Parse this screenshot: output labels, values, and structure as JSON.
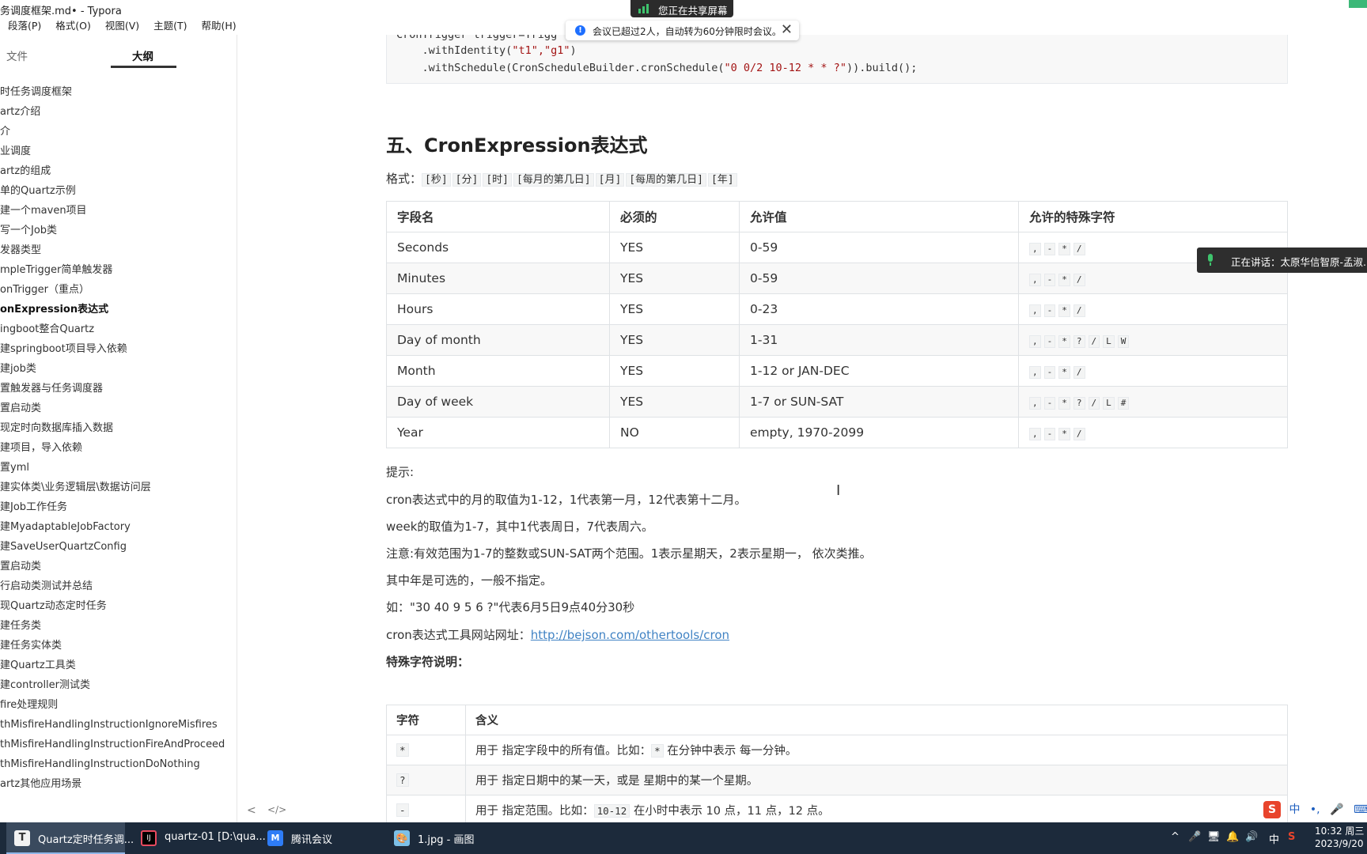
{
  "window": {
    "title": "务调度框架.md• - Typora"
  },
  "menu": [
    "段落(P)",
    "格式(O)",
    "视图(V)",
    "主题(T)",
    "帮助(H)"
  ],
  "sidebar": {
    "tab_file": "文件",
    "tab_outline": "大纲",
    "outline": [
      "时任务调度框架",
      "artz介绍",
      "介",
      "业调度",
      "artz的组成",
      "单的Quartz示例",
      "建一个maven项目",
      "写一个Job类",
      "发器类型",
      "mpleTrigger简单触发器",
      "onTrigger（重点）",
      "onExpression表达式",
      "ingboot整合Quartz",
      "建springboot项目导入依赖",
      "建job类",
      "置触发器与任务调度器",
      "置启动类",
      "现定时向数据库插入数据",
      "建项目，导入依赖",
      "置yml",
      "建实体类\\业务逻辑层\\数据访问层",
      "建Job工作任务",
      "建MyadaptableJobFactory",
      "建SaveUserQuartzConfig",
      "置启动类",
      "行启动类测试并总结",
      "现Quartz动态定时任务",
      "建任务类",
      "建任务实体类",
      "建Quartz工具类",
      "建controller测试类",
      "fire处理规则",
      "thMisfireHandlingInstructionIgnoreMisfires",
      "thMisfireHandlingInstructionFireAndProceed",
      "thMisfireHandlingInstructionDoNothing",
      "artz其他应用场景"
    ],
    "active_index": 11,
    "bottom_left": "<",
    "bottom_code": "</>"
  },
  "code": {
    "line1": "CronTrigger trigger=Trigg",
    "line2_pre": "    .withIdentity(",
    "line2_str": "\"t1\",\"g1\"",
    "line2_post": ")",
    "line3_pre": "    .withSchedule(CronScheduleBuilder.cronSchedule(",
    "line3_str": "\"0 0/2 10-12 * * ?\"",
    "line3_post": ")).build();"
  },
  "heading": "五、CronExpression表达式",
  "format_label": "格式：",
  "format_parts": [
    "[秒]",
    "[分]",
    "[时]",
    "[每月的第几日]",
    "[月]",
    "[每周的第几日]",
    "[年]"
  ],
  "fields_table": {
    "headers": [
      "字段名",
      "必须的",
      "允许值",
      "允许的特殊字符"
    ],
    "rows": [
      {
        "name": "Seconds",
        "required": "YES",
        "allowed": "0-59",
        "chars": [
          ",",
          "-",
          "*",
          "/"
        ]
      },
      {
        "name": "Minutes",
        "required": "YES",
        "allowed": "0-59",
        "chars": [
          ",",
          "-",
          "*",
          "/"
        ]
      },
      {
        "name": "Hours",
        "required": "YES",
        "allowed": "0-23",
        "chars": [
          ",",
          "-",
          "*",
          "/"
        ]
      },
      {
        "name": "Day of month",
        "required": "YES",
        "allowed": "1-31",
        "chars": [
          ",",
          "-",
          "*",
          "?",
          "/",
          "L",
          "W"
        ]
      },
      {
        "name": "Month",
        "required": "YES",
        "allowed": "1-12 or JAN-DEC",
        "chars": [
          ",",
          "-",
          "*",
          "/"
        ]
      },
      {
        "name": "Day of week",
        "required": "YES",
        "allowed": "1-7 or SUN-SAT",
        "chars": [
          ",",
          "-",
          "*",
          "?",
          "/",
          "L",
          "#"
        ]
      },
      {
        "name": "Year",
        "required": "NO",
        "allowed": "empty, 1970-2099",
        "chars": [
          ",",
          "-",
          "*",
          "/"
        ]
      }
    ]
  },
  "tips": {
    "label": "提示:",
    "p1": "cron表达式中的月的取值为1-12，1代表第一月，12代表第十二月。",
    "p2": "week的取值为1-7，其中1代表周日，7代表周六。",
    "p3": "注意:有效范围为1-7的整数或SUN-SAT两个范围。1表示星期天，2表示星期一， 依次类推。",
    "p4": "其中年是可选的，一般不指定。",
    "p5": "如：\"30 40 9 5 6 ?\"代表6月5日9点40分30秒",
    "p6_label": "cron表达式工具网站网址：",
    "p6_link": "http://bejson.com/othertools/cron"
  },
  "special_heading": "特殊字符说明：",
  "chars_table": {
    "headers": [
      "字符",
      "含义"
    ],
    "rows": [
      {
        "char": "*",
        "m1": "用于 指定字段中的所有值。比如：",
        "code": "*",
        "m2": " 在分钟中表示 每一分钟。"
      },
      {
        "char": "?",
        "m1": "用于 指定日期中的某一天，或是 星期中的某一个星期。",
        "code": "",
        "m2": ""
      },
      {
        "char": "-",
        "m1": "用于 指定范围。比如：",
        "code": "10-12",
        "m2": " 在小时中表示 10 点，11 点，12 点。"
      }
    ]
  },
  "overlay": {
    "share": "您正在共享屏幕",
    "notice": "会议已超过2人，自动转为60分钟限时会议。",
    "notice_close": "✕",
    "speaking": "正在讲话：太原华信智原-孟淑...",
    "info_glyph": "!"
  },
  "ime": {
    "logo": "S",
    "items": [
      "中",
      "•,",
      "🎤",
      "⌨"
    ]
  },
  "taskbar": {
    "tasks": [
      {
        "label": "Quartz定时任务调...",
        "color": "#ffffff",
        "icon_text": "T"
      },
      {
        "label": "quartz-01 [D:\\qua...",
        "color": "#e84a5f",
        "icon_text": "IJ"
      },
      {
        "label": "腾讯会议",
        "color": "#2e7cf6",
        "icon_text": "M"
      },
      {
        "label": "1.jpg - 画图",
        "color": "#7cc0e8",
        "icon_text": "🎨"
      }
    ],
    "tray": [
      "^",
      "🎤",
      "🖥",
      "🔔",
      "🔊",
      "中",
      "S"
    ],
    "time": "10:32 周三",
    "date": "2023/9/20"
  }
}
